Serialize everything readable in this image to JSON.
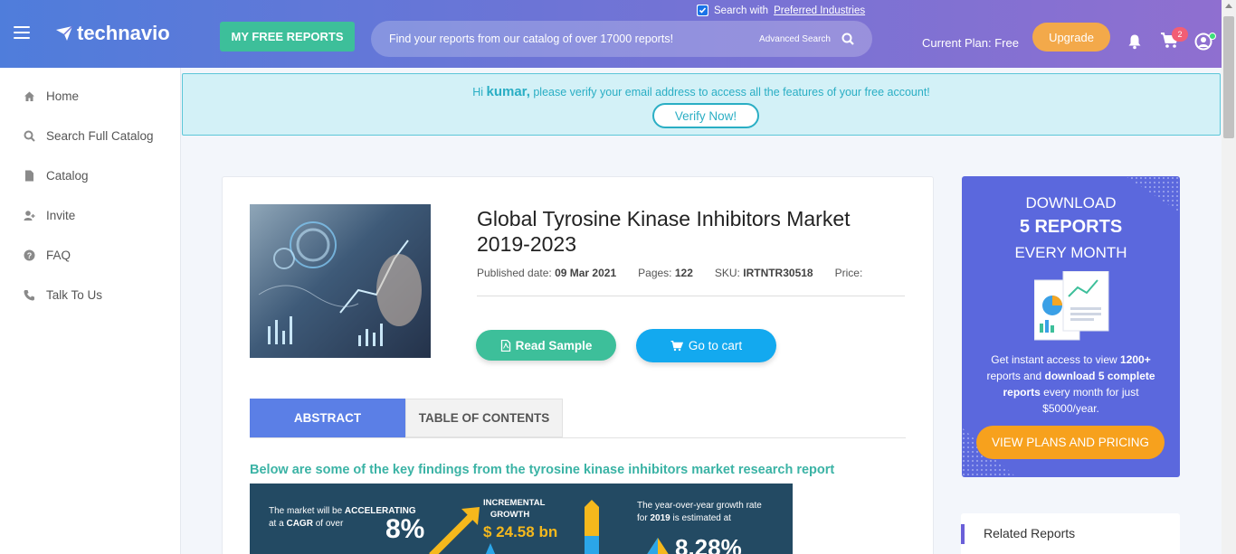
{
  "header": {
    "logo_text": "technavio",
    "free_reports_label": "MY FREE REPORTS",
    "search_placeholder": "Find your reports from our catalog of over 17000 reports!",
    "advanced_search_label": "Advanced Search",
    "preferred_prefix": "Search with",
    "preferred_link": "Preferred Industries",
    "current_plan": "Current Plan: Free",
    "upgrade_label": "Upgrade",
    "cart_count": "2"
  },
  "sidebar": {
    "items": [
      {
        "label": "Home",
        "icon": "home-icon"
      },
      {
        "label": "Search Full Catalog",
        "icon": "search-icon"
      },
      {
        "label": "Catalog",
        "icon": "document-icon"
      },
      {
        "label": "Invite",
        "icon": "add-user-icon"
      },
      {
        "label": "FAQ",
        "icon": "question-icon"
      },
      {
        "label": "Talk To Us",
        "icon": "phone-icon"
      }
    ]
  },
  "verify": {
    "greeting": "Hi",
    "username": "kumar,",
    "message": "please verify your email address to access all the features of your free account!",
    "button_label": "Verify Now!"
  },
  "report": {
    "title": "Global Tyrosine Kinase Inhibitors Market 2019-2023",
    "published_label": "Published date:",
    "published_value": "09 Mar 2021",
    "pages_label": "Pages:",
    "pages_value": "122",
    "sku_label": "SKU:",
    "sku_value": "IRTNTR30518",
    "price_label": "Price:",
    "read_sample_label": "Read Sample",
    "go_to_cart_label": "Go to cart",
    "tabs": [
      "ABSTRACT",
      "TABLE OF CONTENTS"
    ],
    "findings_heading": "Below are some of the key findings from the tyrosine kinase inhibitors market research report",
    "infographic": {
      "text1_pre": "The market will be",
      "text1_bold": "ACCELERATING",
      "text1_mid": "at a",
      "text1_cagr": "CAGR",
      "text1_post": "of over",
      "cagr_value": "8%",
      "incremental_line1": "INCREMENTAL",
      "incremental_line2": "GROWTH",
      "incremental_value": "$ 24.58 bn",
      "yoy_line1": "The year-over-year growth rate",
      "yoy_for": "for",
      "yoy_year": "2019",
      "yoy_post": "is estimated at",
      "yoy_value": "8.28%"
    }
  },
  "promo": {
    "line1": "DOWNLOAD",
    "line2": "5 REPORTS",
    "line3": "EVERY MONTH",
    "desc_1": "Get instant access to view",
    "desc_2": "1200+",
    "desc_3": "reports and",
    "desc_4": "download 5 complete reports",
    "desc_5": "every month for just $5000/year.",
    "button_label": "VIEW PLANS AND PRICING"
  },
  "related": {
    "title": "Related Reports"
  },
  "colors": {
    "accent_green": "#3dbf9a",
    "accent_blue": "#13a9ef",
    "tab_active": "#5b7fe6",
    "promo_bg": "#5b68dd",
    "orange": "#f7a11d"
  }
}
